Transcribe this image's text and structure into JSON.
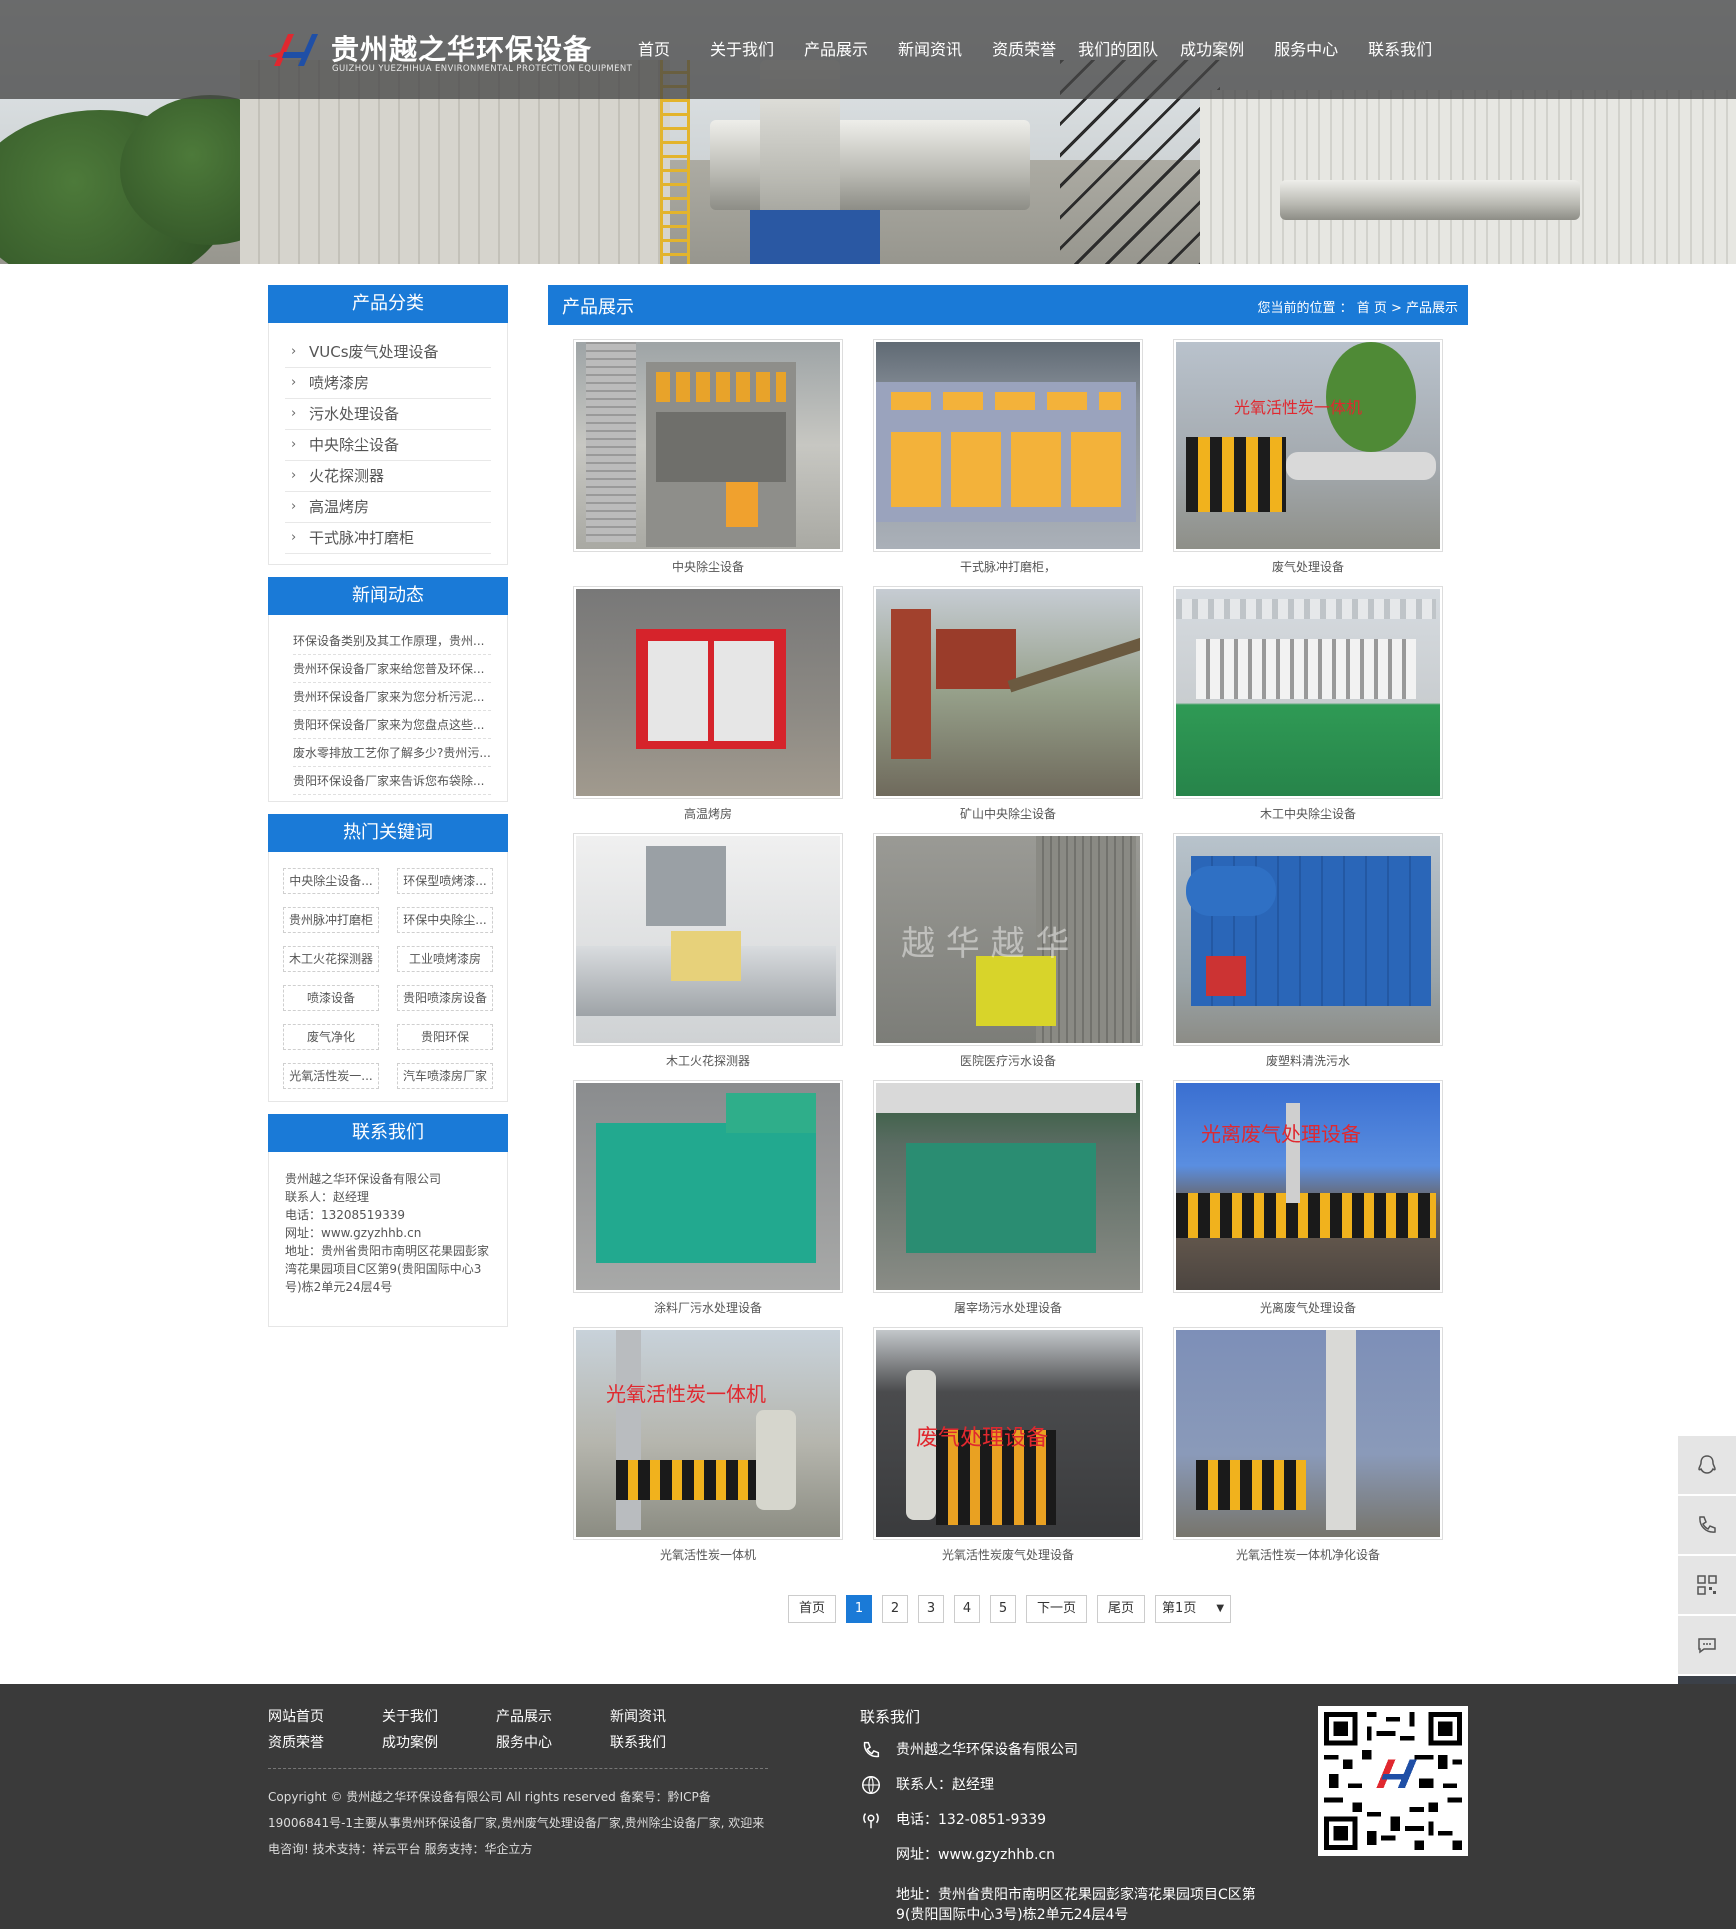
{
  "brand": {
    "name_cn": "贵州越之华环保设备",
    "name_en": "GUIZHOU YUEZHIHUA ENVIRONMENTAL PROTECTION EQUIPMENT",
    "accent": "#1a7ad7"
  },
  "nav": [
    "首页",
    "关于我们",
    "产品展示",
    "新闻资讯",
    "资质荣誉",
    "我们的团队",
    "成功案例",
    "服务中心",
    "联系我们"
  ],
  "sidebar": {
    "categories_title": "产品分类",
    "categories": [
      "VUCs废气处理设备",
      "喷烤漆房",
      "污水处理设备",
      "中央除尘设备",
      "火花探测器",
      "高温烤房",
      "干式脉冲打磨柜"
    ],
    "news_title": "新闻动态",
    "news": [
      "环保设备类别及其工作原理，贵州...",
      "贵州环保设备厂家来给您普及环保...",
      "贵州环保设备厂家来为您分析污泥...",
      "贵阳环保设备厂家来为您盘点这些...",
      "废水零排放工艺你了解多少?贵州污...",
      "贵阳环保设备厂家来告诉您布袋除..."
    ],
    "keywords_title": "热门关键词",
    "keywords": [
      "中央除尘设备...",
      "环保型喷烤漆...",
      "贵州脉冲打磨柜",
      "环保中央除尘...",
      "木工火花探测器",
      "工业喷烤漆房",
      "喷漆设备",
      "贵阳喷漆房设备",
      "废气净化",
      "贵阳环保",
      "光氧活性炭一...",
      "汽车喷漆房厂家"
    ],
    "contact_title": "联系我们",
    "contact_lines": [
      "贵州越之华环保设备有限公司",
      "联系人：赵经理",
      "电话：13208519339",
      "网址：www.gzyzhhb.cn",
      "地址：贵州省贵阳市南明区花果园彭家湾花果园项目C区第9(贵阳国际中心3号)栋2单元24层4号"
    ]
  },
  "main": {
    "title": "产品展示",
    "breadcrumb": "您当前的位置 ： 首 页 > 产品展示",
    "products": [
      {
        "caption": "中央除尘设备",
        "overlay": ""
      },
      {
        "caption": "干式脉冲打磨柜，",
        "overlay": ""
      },
      {
        "caption": "废气处理设备",
        "overlay": "光氧活性炭一体机"
      },
      {
        "caption": "高温烤房",
        "overlay": ""
      },
      {
        "caption": "矿山中央除尘设备",
        "overlay": ""
      },
      {
        "caption": "木工中央除尘设备",
        "overlay": ""
      },
      {
        "caption": "木工火花探测器",
        "overlay": ""
      },
      {
        "caption": "医院医疗污水设备",
        "overlay": "越 华  越 华"
      },
      {
        "caption": "废塑料清洗污水",
        "overlay": ""
      },
      {
        "caption": "涂料厂污水处理设备",
        "overlay": ""
      },
      {
        "caption": "屠宰场污水处理设备",
        "overlay": ""
      },
      {
        "caption": "光离废气处理设备",
        "overlay": "光离废气处理设备"
      },
      {
        "caption": "光氧活性炭一体机",
        "overlay": "光氧活性炭一体机"
      },
      {
        "caption": "光氧活性炭废气处理设备",
        "overlay": "废气处理设备"
      },
      {
        "caption": "光氧活性炭一体机净化设备",
        "overlay": ""
      }
    ],
    "pager": {
      "first": "首页",
      "pages": [
        "1",
        "2",
        "3",
        "4",
        "5"
      ],
      "current": "1",
      "next": "下一页",
      "last": "尾页",
      "select": "第1页"
    }
  },
  "float_icons": [
    "qq-icon",
    "phone-icon",
    "qrcode-icon",
    "message-icon",
    "back-to-top-icon"
  ],
  "footer": {
    "links": [
      "网站首页",
      "关于我们",
      "产品展示",
      "新闻资讯",
      "资质荣誉",
      "成功案例",
      "服务中心",
      "联系我们"
    ],
    "copyright": "Copyright © 贵州越之华环保设备有限公司 All rights reserved 备案号：黔ICP备19006841号-1主要从事贵州环保设备厂家,贵州废气处理设备厂家,贵州除尘设备厂家, 欢迎来电咨询! 技术支持：祥云平台 服务支持：华企立方",
    "contact_title": "联系我们",
    "company": "贵州越之华环保设备有限公司",
    "person": "联系人：赵经理",
    "phone": "电话：132-0851-9339",
    "website": "网址：www.gzyzhhb.cn",
    "address": "地址：贵州省贵阳市南明区花果园彭家湾花果园项目C区第9(贵阳国际中心3号)栋2单元24层4号"
  }
}
